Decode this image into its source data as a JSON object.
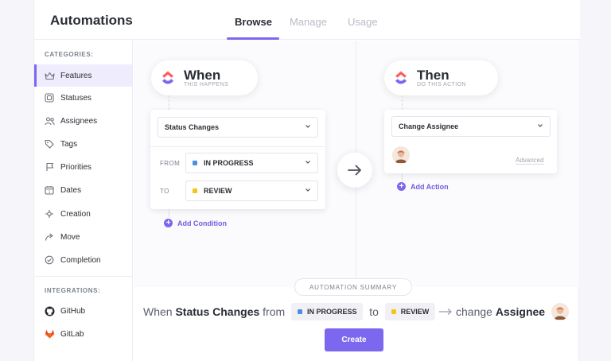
{
  "header": {
    "title": "Automations",
    "tabs": [
      {
        "label": "Browse",
        "active": true
      },
      {
        "label": "Manage",
        "active": false
      },
      {
        "label": "Usage",
        "active": false
      }
    ]
  },
  "sidebar": {
    "categories_label": "CATEGORIES:",
    "categories": [
      {
        "label": "Features",
        "icon": "crown-icon",
        "active": true
      },
      {
        "label": "Statuses",
        "icon": "status-square-icon"
      },
      {
        "label": "Assignees",
        "icon": "people-icon"
      },
      {
        "label": "Tags",
        "icon": "tag-icon"
      },
      {
        "label": "Priorities",
        "icon": "flag-icon"
      },
      {
        "label": "Dates",
        "icon": "calendar-icon"
      },
      {
        "label": "Creation",
        "icon": "creation-plus-icon"
      },
      {
        "label": "Move",
        "icon": "move-arrow-icon"
      },
      {
        "label": "Completion",
        "icon": "check-circle-icon"
      }
    ],
    "integrations_label": "INTEGRATIONS:",
    "integrations": [
      {
        "label": "GitHub",
        "icon": "github-icon"
      },
      {
        "label": "GitLab",
        "icon": "gitlab-icon"
      }
    ]
  },
  "when": {
    "title": "When",
    "subtitle": "THIS HAPPENS",
    "trigger": "Status Changes",
    "from_label": "FROM",
    "from_value": "IN PROGRESS",
    "to_label": "TO",
    "to_value": "REVIEW",
    "add_condition": "Add Condition"
  },
  "then": {
    "title": "Then",
    "subtitle": "DO THIS ACTION",
    "action": "Change Assignee",
    "advanced": "Advanced",
    "add_action": "Add Action"
  },
  "summary": {
    "badge": "AUTOMATION SUMMARY",
    "when_word": "When",
    "trigger": "Status Changes",
    "from_word": "from",
    "from_value": "IN PROGRESS",
    "to_word": "to",
    "to_value": "REVIEW",
    "change_word": "change",
    "action_target": "Assignee"
  },
  "buttons": {
    "create": "Create"
  },
  "colors": {
    "accent": "#7b68ee",
    "in_progress": "#4a90e2",
    "review": "#f5c518",
    "github": "#24292e",
    "gitlab": "#e24329"
  }
}
